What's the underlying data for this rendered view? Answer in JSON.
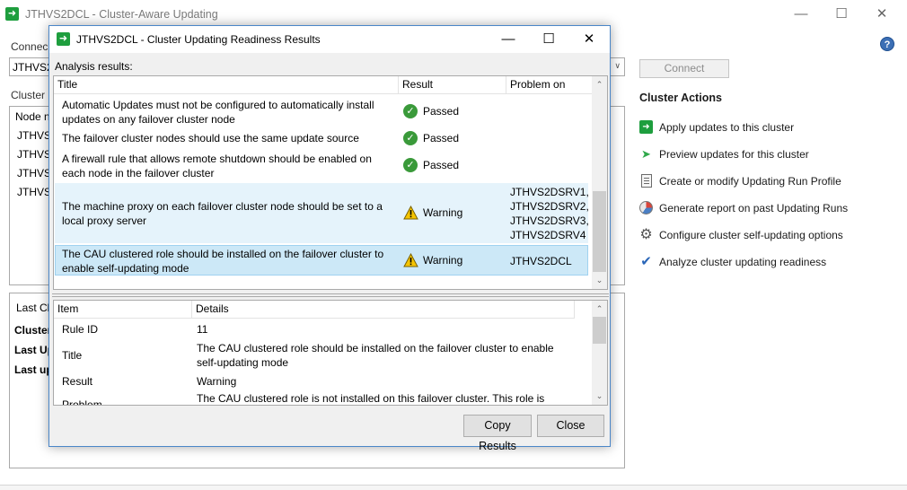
{
  "main": {
    "title": "JTHVS2DCL - Cluster-Aware Updating",
    "connect_label": "Connec",
    "cluster_value": "JTHVS2",
    "cluster_list_label": "Cluster r",
    "node_header": "Node n",
    "nodes": [
      "JTHVS",
      "JTHVS",
      "JTHVS",
      "JTHVS"
    ],
    "connect_button": "Connect",
    "last_label": "Last Cl",
    "bold_labels": [
      "Cluster",
      "Last Up",
      "Last up"
    ],
    "help_glyph": "?"
  },
  "actions": {
    "title": "Cluster Actions",
    "items": [
      {
        "label": "Apply updates to this cluster",
        "icon": "apply-updates-icon"
      },
      {
        "label": "Preview updates for this cluster",
        "icon": "preview-arrow-icon"
      },
      {
        "label": "Create or modify Updating Run Profile",
        "icon": "profile-document-icon"
      },
      {
        "label": "Generate report on past Updating Runs",
        "icon": "report-chart-icon"
      },
      {
        "label": "Configure cluster self-updating options",
        "icon": "gear-icon"
      },
      {
        "label": "Analyze cluster updating readiness",
        "icon": "checkmark-icon"
      }
    ]
  },
  "dialog": {
    "title": "JTHVS2DCL - Cluster Updating Readiness Results",
    "analysis_label": "Analysis results:",
    "columns": [
      "Title",
      "Result",
      "Problem on"
    ],
    "results": [
      {
        "title": "Automatic Updates must not be configured to automatically install updates on any failover cluster node",
        "result": "Passed",
        "problem_on": ""
      },
      {
        "title": "The failover cluster nodes should use the same update source",
        "result": "Passed",
        "problem_on": ""
      },
      {
        "title": "A firewall rule that allows remote shutdown should be enabled on each node in the failover cluster",
        "result": "Passed",
        "problem_on": ""
      },
      {
        "title": "The machine proxy on each failover cluster node should be set to a local proxy server",
        "result": "Warning",
        "problem_on": "JTHVS2DSRV1, JTHVS2DSRV2, JTHVS2DSRV3, JTHVS2DSRV4"
      },
      {
        "title": "The CAU clustered role should be installed on the failover cluster to enable self-updating mode",
        "result": "Warning",
        "problem_on": "JTHVS2DCL"
      }
    ],
    "detail_columns": [
      "Item",
      "Details"
    ],
    "details": [
      {
        "item": "Rule ID",
        "details": "11"
      },
      {
        "item": "Title",
        "details": "The CAU clustered role should be installed on the failover cluster to enable self-updating mode"
      },
      {
        "item": "Result",
        "details": "Warning"
      },
      {
        "item": "Problem",
        "details": "The CAU clustered role is not installed on this failover cluster. This role is"
      }
    ],
    "copy_button": "Copy Results",
    "close_button": "Close"
  },
  "colors": {
    "accent": "#4a86c8",
    "pass": "#3a9a3a",
    "warning": "#f5c400",
    "selection": "#cce8f7"
  }
}
